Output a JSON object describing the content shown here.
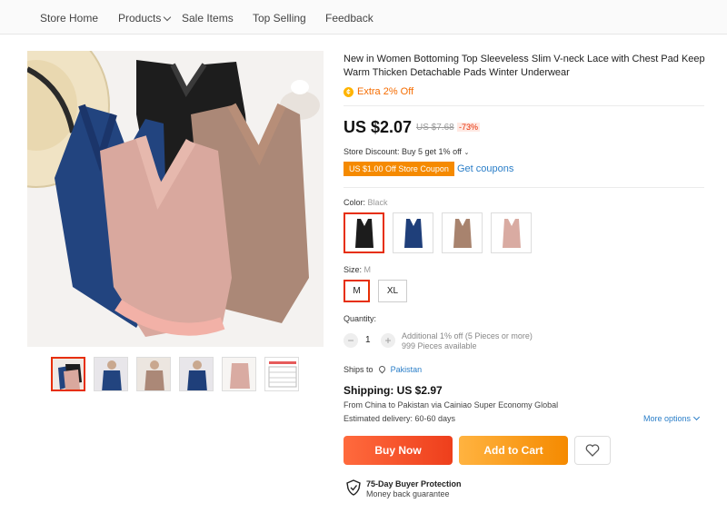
{
  "nav": {
    "items": [
      "Store Home",
      "Products",
      "Sale Items",
      "Top Selling",
      "Feedback"
    ]
  },
  "product": {
    "title": "New in Women Bottoming Top Sleeveless Slim V-neck Lace with Chest Pad Keep Warm Thicken Detachable Pads Winter Underwear",
    "extra_offer": "Extra 2% Off",
    "price": "US $2.07",
    "original_price": "US $7.68",
    "discount": "-73%",
    "store_discount": "Store Discount: Buy 5 get 1% off",
    "coupon_label": "US $1.00 Off Store Coupon",
    "get_coupons": "Get coupons"
  },
  "color": {
    "label": "Color:",
    "selected": "Black",
    "options": [
      {
        "name": "Black",
        "hex": "#1c1c1c"
      },
      {
        "name": "Navy",
        "hex": "#1f3f7a"
      },
      {
        "name": "Brown",
        "hex": "#a8836e"
      },
      {
        "name": "Pink",
        "hex": "#d9aba2"
      }
    ]
  },
  "size": {
    "label": "Size:",
    "selected": "M",
    "options": [
      "M",
      "XL"
    ]
  },
  "quantity": {
    "label": "Quantity:",
    "minus": "−",
    "plus": "+",
    "value": "1",
    "note_line1": "Additional 1% off (5 Pieces or more)",
    "note_line2": "999 Pieces available"
  },
  "shipping": {
    "ships_to_label": "Ships to",
    "ships_to_value": "Pakistan",
    "cost": "Shipping: US $2.97",
    "route": "From China to Pakistan via Cainiao Super Economy Global",
    "estimated": "Estimated delivery: 60-60 days",
    "more_options": "More options"
  },
  "actions": {
    "buy_now": "Buy Now",
    "add_to_cart": "Add to Cart"
  },
  "protection": {
    "title": "75-Day Buyer Protection",
    "subtitle": "Money back guarantee"
  },
  "colors": {
    "accent": "#e62e04",
    "orange": "#f58a00",
    "link": "#2a7ec8"
  }
}
